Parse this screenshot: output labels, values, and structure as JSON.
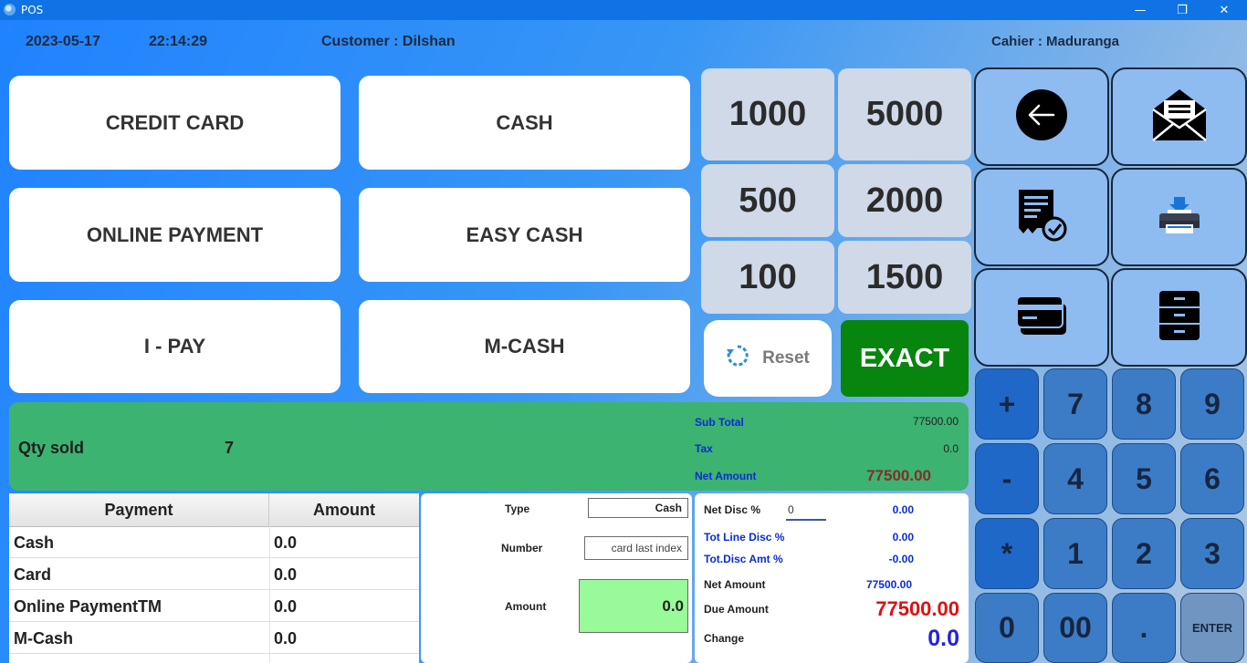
{
  "window": {
    "title": "POS",
    "minimize": "—",
    "restore": "❐",
    "close": "✕"
  },
  "header": {
    "date": "2023-05-17",
    "time": "22:14:29",
    "customer": "Customer : Dilshan",
    "cashier": "Cahier : Maduranga"
  },
  "payment_methods": [
    "CREDIT CARD",
    "CASH",
    "ONLINE PAYMENT",
    "EASY CASH",
    "I - PAY",
    "M-CASH"
  ],
  "denominations": [
    "1000",
    "5000",
    "500",
    "2000",
    "100",
    "1500"
  ],
  "actions": {
    "reset": "Reset",
    "exact": "EXACT"
  },
  "icon_buttons": [
    "back-arrow-icon",
    "mail-icon",
    "receipt-check-icon",
    "printer-icon",
    "credit-card-icon",
    "filing-cabinet-icon"
  ],
  "keypad": [
    "+",
    "7",
    "8",
    "9",
    "-",
    "4",
    "5",
    "6",
    "*",
    "1",
    "2",
    "3",
    "0",
    "00",
    ".",
    "ENTER"
  ],
  "summary": {
    "qty_label": "Qty sold",
    "qty_value": "7",
    "sub_total_label": "Sub Total",
    "sub_total_value": "77500.00",
    "tax_label": "Tax",
    "tax_value": "0.0",
    "net_amount_label": "Net Amount",
    "net_amount_value": "77500.00"
  },
  "payments_table": {
    "headers": [
      "Payment",
      "Amount"
    ],
    "rows": [
      [
        "Cash",
        "0.0"
      ],
      [
        "Card",
        "0.0"
      ],
      [
        "Online PaymentTM",
        "0.0"
      ],
      [
        "M-Cash",
        "0.0"
      ]
    ]
  },
  "entry": {
    "type_label": "Type",
    "type_value": "Cash",
    "number_label": "Number",
    "number_placeholder": "card last index",
    "amount_label": "Amount",
    "amount_value": "0.0"
  },
  "totals": {
    "net_disc_label": "Net Disc %",
    "net_disc_input": "0",
    "net_disc_value": "0.00",
    "tot_line_disc_label": "Tot Line Disc %",
    "tot_line_disc_value": "0.00",
    "tot_disc_amt_label": "Tot.Disc Amt %",
    "tot_disc_amt_value": "-0.00",
    "net_amount_label": "Net Amount",
    "net_amount_value": "77500.00",
    "due_amount_label": "Due Amount",
    "due_amount_value": "77500.00",
    "change_label": "Change",
    "change_value": "0.0"
  },
  "colors": {
    "exact": "#08850f",
    "summary": "#3cb371",
    "due": "#e01010",
    "change": "#2222dd",
    "net": "#8b2a2a"
  }
}
